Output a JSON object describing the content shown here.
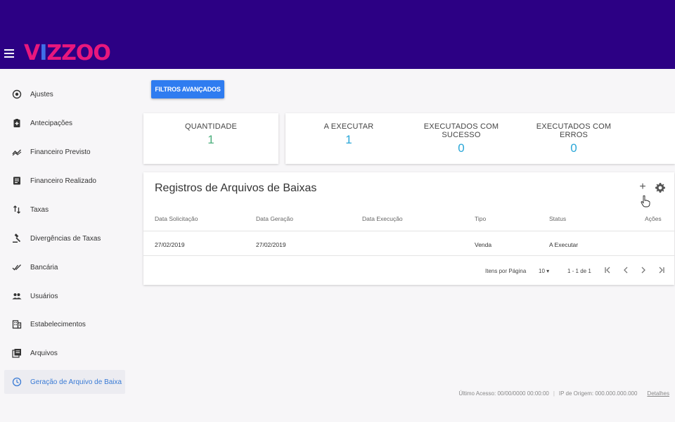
{
  "brand": {
    "logo_v": "V",
    "logo_i": "I",
    "logo_zz": "ZZ",
    "logo_oo": "OO"
  },
  "sidebar": {
    "items": [
      {
        "label": "Ajustes",
        "icon": "target-icon"
      },
      {
        "label": "Antecipações",
        "icon": "clipboard-plus-icon"
      },
      {
        "label": "Financeiro Previsto",
        "icon": "trending-icon"
      },
      {
        "label": "Financeiro Realizado",
        "icon": "document-icon"
      },
      {
        "label": "Taxas",
        "icon": "swap-vertical-icon"
      },
      {
        "label": "Divergências de Taxas",
        "icon": "gavel-icon"
      },
      {
        "label": "Bancária",
        "icon": "double-check-icon"
      },
      {
        "label": "Usuários",
        "icon": "users-icon"
      },
      {
        "label": "Estabelecimentos",
        "icon": "building-icon"
      },
      {
        "label": "Arquivos",
        "icon": "library-icon"
      },
      {
        "label": "Geração de Arquivo de Baixa",
        "icon": "clock-icon",
        "active": true
      }
    ]
  },
  "filters_button": "FILTROS AVANÇADOS",
  "stats": {
    "quantidade": {
      "title": "QUANTIDADE",
      "value": "1"
    },
    "a_executar": {
      "title": "A EXECUTAR",
      "value": "1"
    },
    "sucesso": {
      "title": "EXECUTADOS COM SUCESSO",
      "value": "0"
    },
    "erros": {
      "title": "EXECUTADOS COM ERROS",
      "value": "0"
    }
  },
  "colors": {
    "topbar": "#2c0084",
    "green_value": "#4caf7d",
    "blue_value": "#2aa7d8",
    "button": "#2f7cf0"
  },
  "table": {
    "title": "Registros de Arquivos de Baixas",
    "columns": [
      "Data Solicitação",
      "Data Geração",
      "Data Execução",
      "Tipo",
      "Status",
      "Ações"
    ],
    "rows": [
      [
        "27/02/2019",
        "27/02/2019",
        "",
        "Venda",
        "A Executar",
        ""
      ]
    ],
    "pagination": {
      "items_label": "Itens por Página",
      "page_size": "10",
      "range": "1 - 1 de 1"
    }
  },
  "footer": {
    "last_access": "Último Acesso: 00/00/0000 00:00:00",
    "origin_ip": "IP de Origem: 000.000.000.000",
    "details": "Detalhes"
  }
}
